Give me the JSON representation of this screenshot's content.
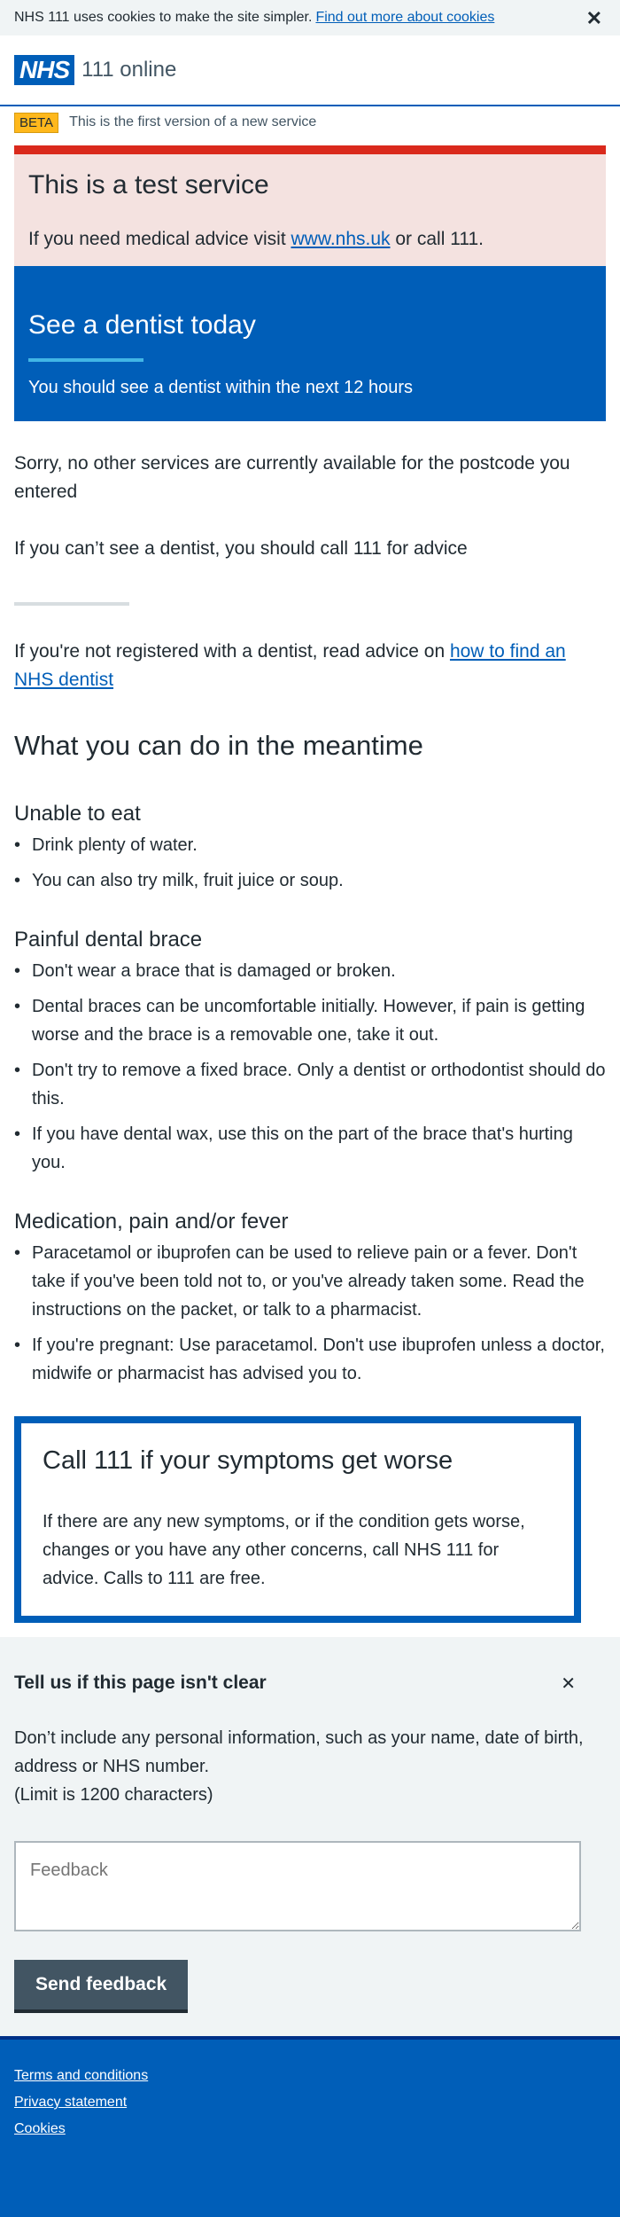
{
  "cookie_banner": {
    "text": "NHS 111 uses cookies to make the site simpler.",
    "link": "Find out more about cookies",
    "close": "✕"
  },
  "header": {
    "logo": "NHS",
    "service": "111 online"
  },
  "beta": {
    "tag": "BETA",
    "text": "This is the first version of a new service"
  },
  "test_banner": {
    "title": "This is a test service",
    "text_before": "If you need medical advice visit ",
    "link": "www.nhs.uk",
    "text_after": " or call 111."
  },
  "result": {
    "title": "See a dentist today",
    "text": "You should see a dentist within the next 12 hours"
  },
  "content": {
    "sorry": "Sorry, no other services are currently available for the postcode you entered",
    "cant_see": "If you can’t see a dentist, you should call 111 for advice",
    "not_registered_before": "If you're not registered with a dentist, read advice on ",
    "not_registered_link": "how to find an NHS dentist",
    "meantime_heading": "What you can do in the meantime"
  },
  "advice_sections": [
    {
      "heading": "Unable to eat",
      "items": [
        "Drink plenty of water.",
        "You can also try milk, fruit juice or soup."
      ]
    },
    {
      "heading": "Painful dental brace",
      "items": [
        "Don't wear a brace that is damaged or broken.",
        "Dental braces can be uncomfortable initially. However, if pain is getting worse and the brace is a removable one, take it out.",
        "Don't try to remove a fixed brace. Only a dentist or orthodontist should do this.",
        "If you have dental wax, use this on the part of the brace that's hurting you."
      ]
    },
    {
      "heading": "Medication, pain and/or fever",
      "items": [
        "Paracetamol or ibuprofen can be used to relieve pain or a fever. Don't take if you've been told not to, or you've already taken some. Read the instructions on the packet, or talk to a pharmacist.",
        "If you're pregnant: Use paracetamol. Don't use ibuprofen unless a doctor, midwife or pharmacist has advised you to."
      ]
    }
  ],
  "care_card": {
    "title": "Call 111 if your symptoms get worse",
    "text": "If there are any new symptoms, or if the condition gets worse, changes or you have any other concerns, call NHS 111 for advice. Calls to 111 are free."
  },
  "feedback": {
    "title": "Tell us if this page isn't clear",
    "close": "✕",
    "text": "Don’t include any personal information, such as your name, date of birth, address or NHS number.",
    "limit": "(Limit is 1200 characters)",
    "placeholder": "Feedback",
    "button": "Send feedback"
  },
  "footer": {
    "links": [
      "Terms and conditions",
      "Privacy statement",
      "Cookies"
    ]
  },
  "colors": {
    "nhs_blue": "#005eb8",
    "emergency_red": "#da291c",
    "beta_yellow": "#ffb81c",
    "grey_bg": "#f0f4f5"
  }
}
